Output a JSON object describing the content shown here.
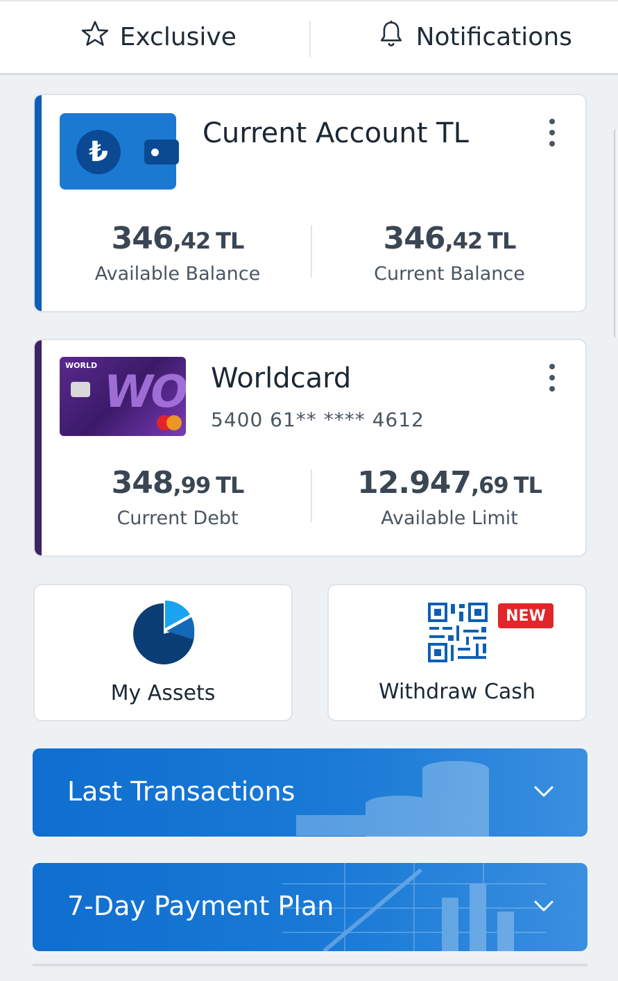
{
  "topbar": {
    "exclusive_label": "Exclusive",
    "exclusive_icon": "star-icon",
    "notifications_label": "Notifications",
    "notifications_icon": "bell-icon"
  },
  "account_card": {
    "title": "Current Account TL",
    "icon": "wallet-lira-icon",
    "currency_symbol": "₺",
    "available_balance": {
      "int": "346",
      "dec": ",42",
      "currency": "TL",
      "label": "Available Balance"
    },
    "current_balance": {
      "int": "346",
      "dec": ",42",
      "currency": "TL",
      "label": "Current Balance"
    },
    "accent_color": "#0d5fb5"
  },
  "credit_card": {
    "title": "Worldcard",
    "number": "5400 61** **** 4612",
    "image_brand": "WORLD",
    "current_debt": {
      "int": "348",
      "dec": ",99",
      "currency": "TL",
      "label": "Current Debt"
    },
    "available_limit": {
      "int": "12.947",
      "dec": ",69",
      "currency": "TL",
      "label": "Available Limit"
    },
    "accent_color": "#3a2461"
  },
  "tiles": {
    "assets": {
      "label": "My Assets",
      "icon": "pie-chart-icon"
    },
    "cash": {
      "label": "Withdraw Cash",
      "icon": "qr-code-icon",
      "badge": "NEW"
    }
  },
  "banners": {
    "transactions": {
      "label": "Last Transactions"
    },
    "payment_plan": {
      "label": "7-Day Payment Plan"
    }
  },
  "colors": {
    "brand_blue": "#1a7ad6",
    "badge_red": "#e0262a",
    "background": "#eef1f4"
  }
}
